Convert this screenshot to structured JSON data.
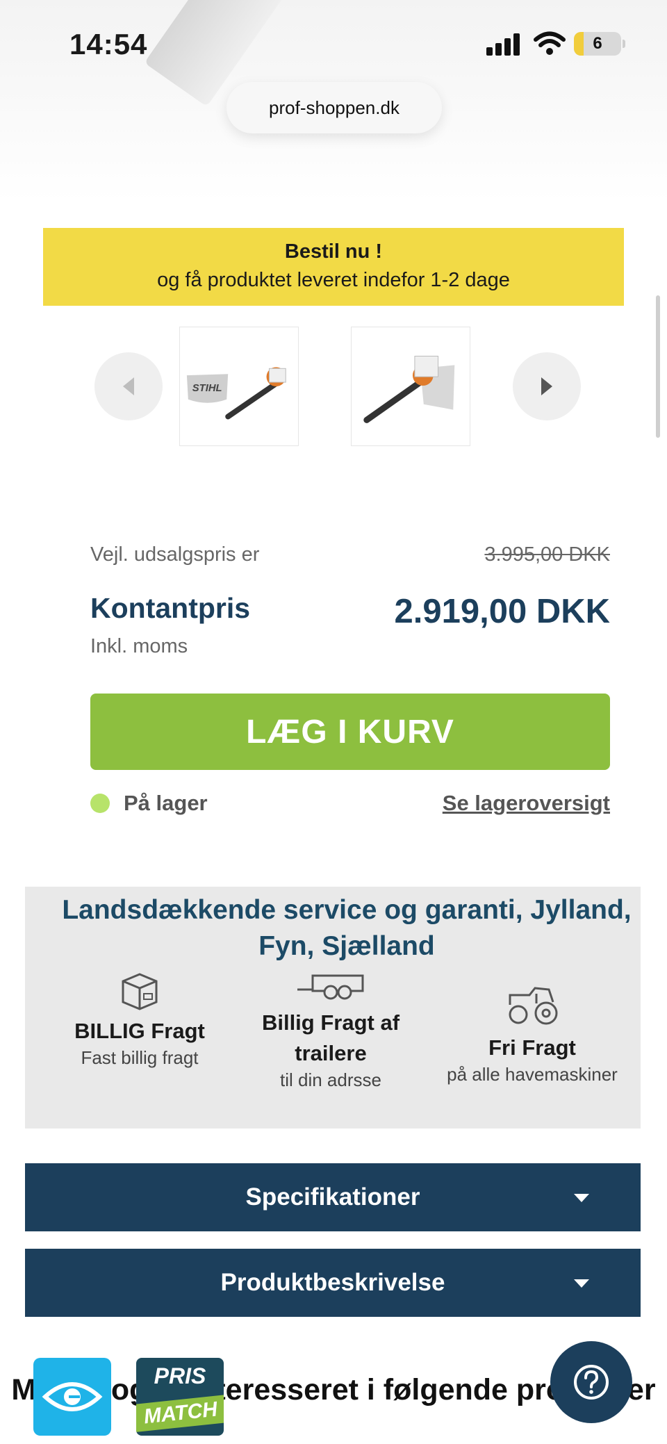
{
  "status_bar": {
    "time": "14:54",
    "battery": "6"
  },
  "browser": {
    "url": "prof-shoppen.dk"
  },
  "banner": {
    "line1": "Bestil nu !",
    "line2": "og få produktet leveret indefor 1-2 dage"
  },
  "carousel": {
    "thumbnails": [
      {
        "label": "STIHL"
      },
      {
        "label": ""
      }
    ]
  },
  "price": {
    "suggested_label": "Vejl. udsalgspris er",
    "suggested_value": "3.995,00 DKK",
    "cash_label": "Kontantpris",
    "cash_value": "2.919,00 DKK",
    "vat_note": "Inkl. moms"
  },
  "cart_button": {
    "label": "LÆG I KURV"
  },
  "stock": {
    "status": "På lager",
    "link": "Se lageroversigt",
    "status_color": "#b7e36a"
  },
  "service": {
    "title": "Landsdækkende service og garanti, Jylland, Fyn, Sjælland",
    "features": [
      {
        "title": "BILLIG Fragt",
        "subtitle": "Fast billig fragt",
        "icon": "box-icon"
      },
      {
        "title": "Billig Fragt af trailere",
        "subtitle": "til din adrsse",
        "icon": "trailer-icon"
      },
      {
        "title": "Fri Fragt",
        "subtitle": "på alle havemaskiner",
        "icon": "tractor-icon"
      }
    ]
  },
  "accordions": [
    {
      "label": "Specifikationer"
    },
    {
      "label": "Produktbeskrivelse"
    }
  ],
  "related": {
    "title": "Måske også interesseret i følgende produkter"
  },
  "badges": {
    "prismatch_top": "PRIS",
    "prismatch_bottom": "MATCH"
  },
  "colors": {
    "brand_navy": "#1c3f5c",
    "cart_green": "#8dbf3f",
    "banner_yellow": "#f2da46"
  }
}
